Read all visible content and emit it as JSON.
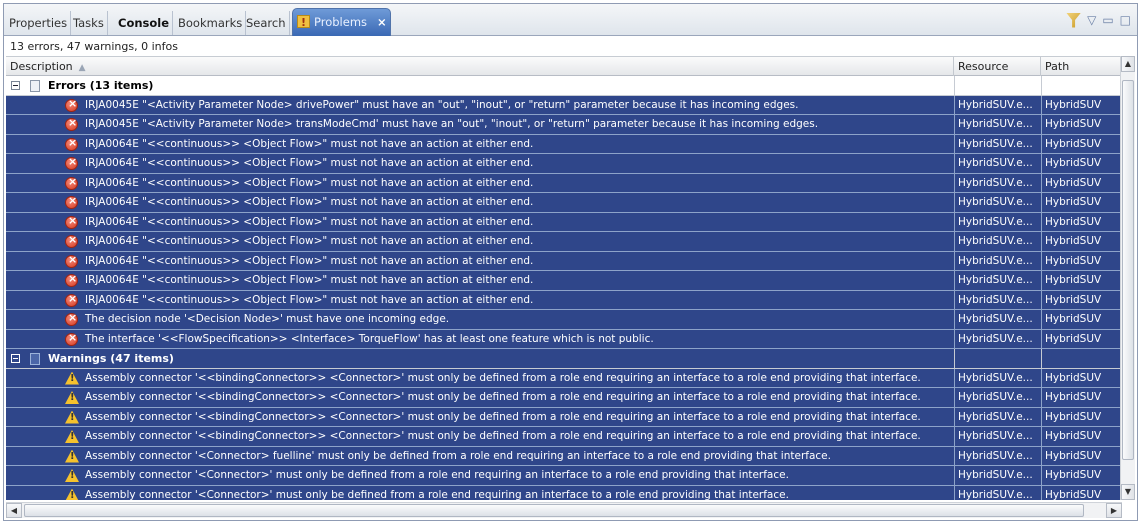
{
  "tabs": [
    {
      "label": "Properties",
      "bold": false
    },
    {
      "label": "Tasks",
      "bold": false
    },
    {
      "label": "Console",
      "bold": true
    },
    {
      "label": "Bookmarks",
      "bold": false
    },
    {
      "label": "Search",
      "bold": false
    },
    {
      "label": "Problems",
      "bold": false,
      "active": true
    }
  ],
  "tab_close_glyph": "×",
  "summary": "13 errors, 47 warnings, 0 infos",
  "columns": {
    "description": "Description",
    "resource": "Resource",
    "path": "Path"
  },
  "groups": {
    "errors_label": "Errors (13 items)",
    "warnings_label": "Warnings (47 items)"
  },
  "errors": [
    {
      "desc": "IRJA0045E \"<Activity Parameter Node> drivePower\" must have an \"out\", \"inout\", or \"return\" parameter because it has incoming edges.",
      "resource": "HybridSUV.e...",
      "path": "HybridSUV"
    },
    {
      "desc": "IRJA0045E \"<Activity Parameter Node> transModeCmd' must have an \"out\", \"inout\", or \"return\" parameter because it has incoming edges.",
      "resource": "HybridSUV.e...",
      "path": "HybridSUV"
    },
    {
      "desc": "IRJA0064E \"<<continuous>> <Object Flow>\" must not have an action at either end.",
      "resource": "HybridSUV.e...",
      "path": "HybridSUV"
    },
    {
      "desc": "IRJA0064E \"<<continuous>> <Object Flow>\" must not have an action at either end.",
      "resource": "HybridSUV.e...",
      "path": "HybridSUV"
    },
    {
      "desc": "IRJA0064E \"<<continuous>> <Object Flow>\" must not have an action at either end.",
      "resource": "HybridSUV.e...",
      "path": "HybridSUV"
    },
    {
      "desc": "IRJA0064E \"<<continuous>> <Object Flow>\" must not have an action at either end.",
      "resource": "HybridSUV.e...",
      "path": "HybridSUV"
    },
    {
      "desc": "IRJA0064E \"<<continuous>> <Object Flow>\" must not have an action at either end.",
      "resource": "HybridSUV.e...",
      "path": "HybridSUV"
    },
    {
      "desc": "IRJA0064E \"<<continuous>> <Object Flow>\" must not have an action at either end.",
      "resource": "HybridSUV.e...",
      "path": "HybridSUV"
    },
    {
      "desc": "IRJA0064E \"<<continuous>> <Object Flow>\" must not have an action at either end.",
      "resource": "HybridSUV.e...",
      "path": "HybridSUV"
    },
    {
      "desc": "IRJA0064E \"<<continuous>> <Object Flow>\" must not have an action at either end.",
      "resource": "HybridSUV.e...",
      "path": "HybridSUV"
    },
    {
      "desc": "IRJA0064E \"<<continuous>> <Object Flow>\" must not have an action at either end.",
      "resource": "HybridSUV.e...",
      "path": "HybridSUV"
    },
    {
      "desc": "The decision node '<Decision Node>' must have one incoming edge.",
      "resource": "HybridSUV.e...",
      "path": "HybridSUV"
    },
    {
      "desc": "The interface '<<FlowSpecification>> <Interface> TorqueFlow' has at least one feature which is not public.",
      "resource": "HybridSUV.e...",
      "path": "HybridSUV"
    }
  ],
  "warnings": [
    {
      "desc": "Assembly connector '<<bindingConnector>> <Connector>' must only be defined from a role end requiring an interface to a role end providing that interface.",
      "resource": "HybridSUV.e...",
      "path": "HybridSUV"
    },
    {
      "desc": "Assembly connector '<<bindingConnector>> <Connector>' must only be defined from a role end requiring an interface to a role end providing that interface.",
      "resource": "HybridSUV.e...",
      "path": "HybridSUV"
    },
    {
      "desc": "Assembly connector '<<bindingConnector>> <Connector>' must only be defined from a role end requiring an interface to a role end providing that interface.",
      "resource": "HybridSUV.e...",
      "path": "HybridSUV"
    },
    {
      "desc": "Assembly connector '<<bindingConnector>> <Connector>' must only be defined from a role end requiring an interface to a role end providing that interface.",
      "resource": "HybridSUV.e...",
      "path": "HybridSUV"
    },
    {
      "desc": "Assembly connector '<Connector> fuelline' must only be defined from a role end requiring an interface to a role end providing that interface.",
      "resource": "HybridSUV.e...",
      "path": "HybridSUV"
    },
    {
      "desc": "Assembly connector '<Connector>' must only be defined from a role end requiring an interface to a role end providing that interface.",
      "resource": "HybridSUV.e...",
      "path": "HybridSUV"
    },
    {
      "desc": "Assembly connector '<Connector>' must only be defined from a role end requiring an interface to a role end providing that interface.",
      "resource": "HybridSUV.e...",
      "path": "HybridSUV"
    }
  ],
  "icons": {
    "error": "error-icon",
    "warning": "warning-icon",
    "problems_tab": "problems-icon"
  },
  "colors": {
    "selection": "#2f468a",
    "active_tab": "#4a78c2",
    "error": "#d2381f",
    "warning": "#f5c22d"
  }
}
